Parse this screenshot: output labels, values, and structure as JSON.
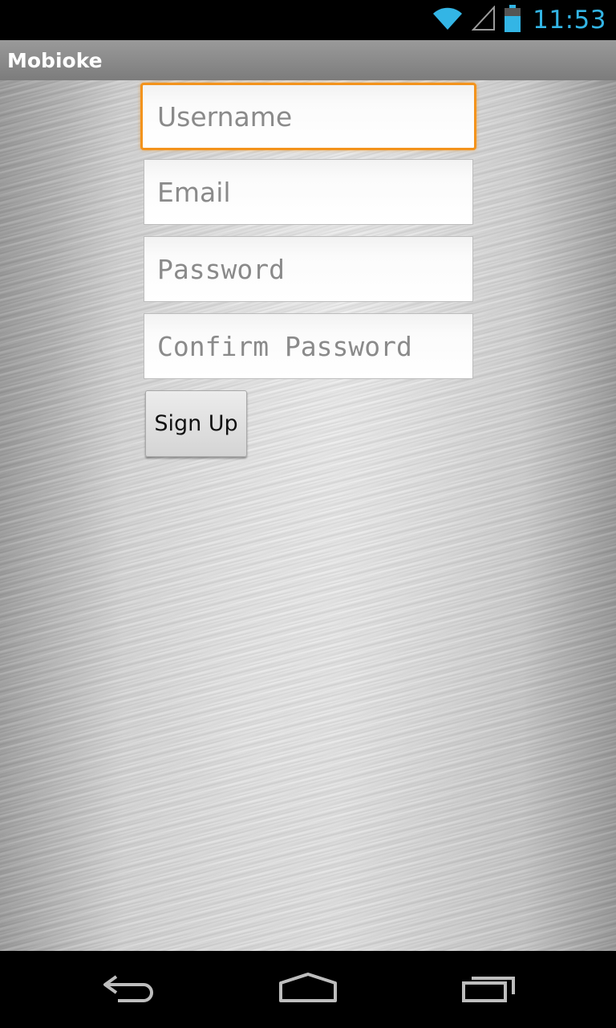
{
  "status_bar": {
    "time": "11:53",
    "icons": [
      "wifi-icon",
      "cell-signal-icon",
      "battery-icon"
    ],
    "accent_color": "#33b5e5"
  },
  "action_bar": {
    "title": "Mobioke"
  },
  "form": {
    "username": {
      "placeholder": "Username",
      "value": ""
    },
    "email": {
      "placeholder": "Email",
      "value": ""
    },
    "password": {
      "placeholder": "Password",
      "value": ""
    },
    "confirm_password": {
      "placeholder": "Confirm Password",
      "value": ""
    },
    "signup_label": "Sign Up",
    "focus_color": "#f3931c"
  },
  "nav_bar": {
    "icons": [
      "back-icon",
      "home-icon",
      "recent-apps-icon"
    ]
  }
}
